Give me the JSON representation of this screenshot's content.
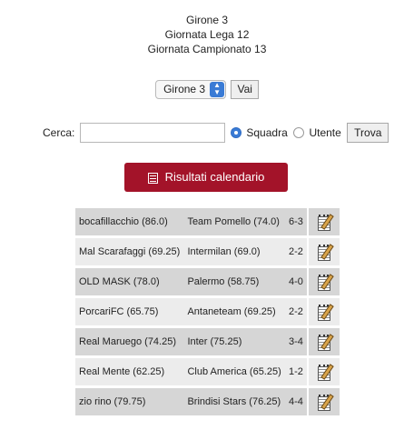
{
  "header": {
    "line1": "Girone 3",
    "line2": "Giornata Lega 12",
    "line3": "Giornata Campionato 13"
  },
  "group_select": {
    "selected": "Girone 3",
    "go_label": "Vai"
  },
  "search": {
    "label": "Cerca:",
    "value": "",
    "options": [
      {
        "label": "Squadra",
        "selected": true
      },
      {
        "label": "Utente",
        "selected": false
      }
    ],
    "submit_label": "Trova"
  },
  "results_button": {
    "label": "Risultati calendario",
    "icon": "calendar-list-icon"
  },
  "matches": [
    {
      "home": "bocafillacchio (86.0)",
      "away": "Team Pomello (74.0)",
      "score": "6-3"
    },
    {
      "home": "Mal Scarafaggi (69.25)",
      "away": "Intermilan (69.0)",
      "score": "2-2"
    },
    {
      "home": "OLD MASK (78.0)",
      "away": "Palermo (58.75)",
      "score": "4-0"
    },
    {
      "home": "PorcariFC (65.75)",
      "away": "Antaneteam (69.25)",
      "score": "2-2"
    },
    {
      "home": "Real Maruego (74.25)",
      "away": "Inter (75.25)",
      "score": "3-4"
    },
    {
      "home": "Real Mente (62.25)",
      "away": "Club America (65.25)",
      "score": "1-2"
    },
    {
      "home": "zio rino (79.75)",
      "away": "Brindisi Stars (76.25)",
      "score": "4-4"
    }
  ],
  "colors": {
    "accent": "#a31329",
    "row_dark": "#d6d6d6",
    "row_light": "#ececec",
    "radio_selected": "#3a7bd5"
  }
}
